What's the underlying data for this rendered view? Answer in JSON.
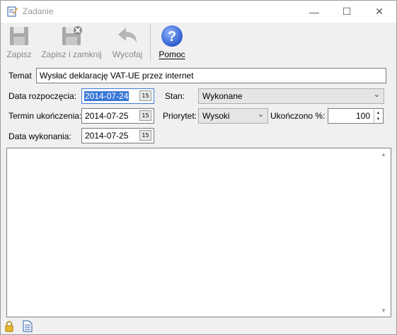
{
  "window": {
    "title": "Zadanie",
    "minimize_glyph": "—",
    "maximize_glyph": "☐",
    "close_glyph": "✕",
    "title_icon": "edit-task-icon"
  },
  "toolbar": {
    "save": {
      "label": "Zapisz",
      "icon": "floppy-disk-icon"
    },
    "save_close": {
      "label": "Zapisz i zamknij",
      "icon": "floppy-close-icon"
    },
    "undo": {
      "label": "Wycofaj",
      "icon": "undo-arrow-icon"
    },
    "help": {
      "label": "Pomoc",
      "icon": "help-question-icon",
      "help_glyph": "?"
    }
  },
  "form": {
    "subject_label": "Temat",
    "subject_value": "Wysłać deklarację VAT-UE przez internet",
    "start_label": "Data rozpoczęcia:",
    "start_value": "2014-07-24",
    "due_label": "Termin ukończenia:",
    "due_value": "2014-07-25",
    "done_label": "Data wykonania:",
    "done_value": "2014-07-25",
    "status_label": "Stan:",
    "status_value": "Wykonane",
    "priority_label": "Priorytet:",
    "priority_value": "Wysoki",
    "percent_label": "Ukończono %:",
    "percent_value": "100",
    "calendar_glyph": "15",
    "chevron_glyph": "⌄",
    "spin_up_glyph": "▲",
    "spin_down_glyph": "▼"
  },
  "memo": {
    "text": "",
    "scroll_up_glyph": "▲",
    "scroll_down_glyph": "▼"
  },
  "statusbar": {
    "lock_icon": "lock-icon",
    "note_icon": "note-icon"
  }
}
